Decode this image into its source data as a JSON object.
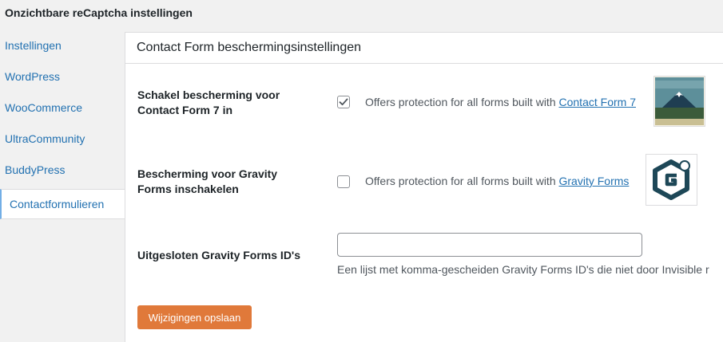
{
  "page": {
    "title": "Onzichtbare reCaptcha instellingen"
  },
  "sidebar": {
    "items": [
      {
        "label": "Instellingen"
      },
      {
        "label": "WordPress"
      },
      {
        "label": "WooCommerce"
      },
      {
        "label": "UltraCommunity"
      },
      {
        "label": "BuddyPress"
      },
      {
        "label": "Contactformulieren",
        "active": true
      }
    ]
  },
  "panel": {
    "heading": "Contact Form beschermingsinstellingen",
    "rows": [
      {
        "label": "Schakel bescherming voor Contact Form 7 in",
        "checked": true,
        "description_prefix": "Offers protection for all forms built with ",
        "link_text": "Contact Form 7",
        "thumbnail_icon": "contact-form-7-logo-mountain"
      },
      {
        "label": "Bescherming voor Gravity Forms inschakelen",
        "checked": false,
        "description_prefix": "Offers protection for all forms built with ",
        "link_text": "Gravity Forms",
        "thumbnail_icon": "gravity-forms-logo"
      },
      {
        "label": "Uitgesloten Gravity Forms ID's",
        "input_value": "",
        "hint": "Een lijst met komma-gescheiden Gravity Forms ID's die niet door Invisible r"
      }
    ],
    "save_label": "Wijzigingen opslaan"
  },
  "colors": {
    "accent": "#2271b1",
    "save_button": "#e0793a",
    "background": "#f1f1f1"
  }
}
